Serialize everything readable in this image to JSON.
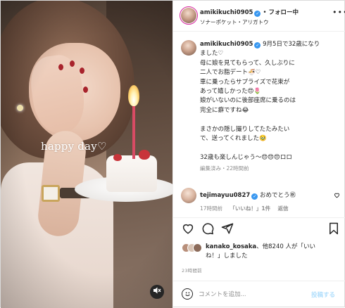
{
  "post": {
    "media": {
      "overlay_caption": "happy day♡",
      "mute_icon": "speaker-muted-icon"
    },
    "header": {
      "username": "amikikuchi0905",
      "verified": true,
      "separator": "•",
      "follow_state": "フォロー中",
      "audio": "ソナーポケット・アリガトウ",
      "more_icon": "more-options-icon"
    },
    "caption": {
      "username": "amikikuchi0905",
      "first_line": "9月5日で32歳になり",
      "lines": [
        "ました♡",
        "母に娘を見てもらって、久しぶりに",
        "二人でお脂デート🍜♡",
        "車に乗ったらサプライズで花束が",
        "あって嬉しかった😍🌷",
        "娘がいないのに後部座席に乗るのは",
        "完全に癖ですね😂",
        "",
        "まさかの隠し撮りしてたたみたい",
        "で、送ってくれました🥹",
        "",
        "32歳も楽しんじゃう〜😍😍😍ロロ"
      ],
      "meta": "編集済み・22時間前"
    },
    "reply": {
      "username": "tejimayuu0827",
      "verified": true,
      "text": "おめでとう㊗",
      "time": "17時間前",
      "likes": "「いいね！」1件",
      "reply_label": "返信"
    },
    "actions": {
      "like_icon": "heart-icon",
      "comment_icon": "comment-icon",
      "share_icon": "share-icon",
      "save_icon": "bookmark-icon"
    },
    "likes": {
      "user": "kanako_kosaka",
      "text_a": "、他8240 人が「いい",
      "text_b": "ね！」しました"
    },
    "timestamp": "23時間前",
    "add_comment": {
      "placeholder": "コメントを追加...",
      "post_label": "投稿する",
      "emoji_icon": "emoji-icon"
    }
  },
  "colors": {
    "text": "#262626",
    "muted": "#8e8e8e",
    "link_disabled": "#b2dffc",
    "verified": "#3897f0",
    "border": "#dbdbdb"
  }
}
